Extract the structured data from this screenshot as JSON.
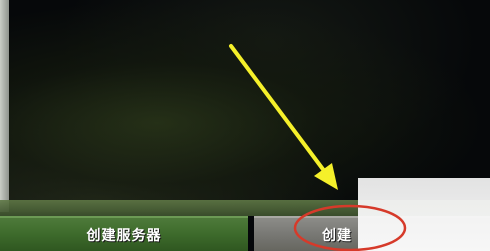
{
  "buttons": {
    "create_server": "创建服务器",
    "create_world_partial": "创建"
  },
  "annotation": {
    "arrow_color": "#f5f02a",
    "circle_color": "#d63a2a"
  }
}
